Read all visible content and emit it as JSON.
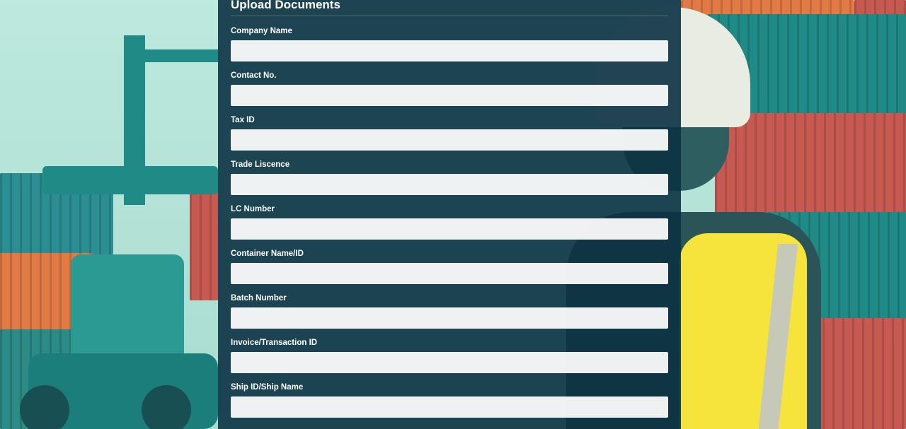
{
  "form": {
    "title": "Upload Documents",
    "fields": [
      {
        "label": "Company Name",
        "value": ""
      },
      {
        "label": "Contact No.",
        "value": ""
      },
      {
        "label": "Tax ID",
        "value": ""
      },
      {
        "label": "Trade Liscence",
        "value": ""
      },
      {
        "label": "LC Number",
        "value": ""
      },
      {
        "label": "Container Name/ID",
        "value": ""
      },
      {
        "label": "Batch Number",
        "value": ""
      },
      {
        "label": "Invoice/Transaction ID",
        "value": ""
      },
      {
        "label": "Ship ID/Ship Name",
        "value": ""
      }
    ]
  },
  "theme": {
    "panel_bg": "#0c3242",
    "input_bg": "#ffffff",
    "label_color": "#ffffff",
    "container_teal": "#1f8a86",
    "container_red": "#c65a52",
    "container_orange": "#e17a45",
    "vest_yellow": "#f4e43b"
  }
}
